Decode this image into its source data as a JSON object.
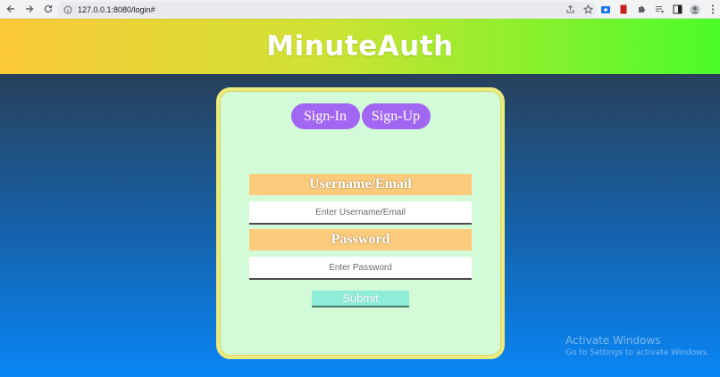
{
  "browser": {
    "url": "127.0.0.1:8080/login#"
  },
  "header": {
    "title": "MinuteAuth"
  },
  "tabs": [
    {
      "label": "Sign-In"
    },
    {
      "label": "Sign-Up"
    }
  ],
  "form": {
    "username_label": "Username/Email",
    "username_placeholder": "Enter Username/Email",
    "password_label": "Password",
    "password_placeholder": "Enter Password",
    "submit_label": "Submit"
  },
  "watermark": {
    "title": "Activate Windows",
    "subtitle": "Go to Settings to activate Windows."
  },
  "colors": {
    "header_start": "#fcc93a",
    "header_end": "#4bfc2a",
    "card_bg": "#d4fbd8",
    "tab_bg": "#a267f2",
    "label_bg": "#fccc7c",
    "submit_bg": "#8eecd9"
  },
  "icons": [
    "back-icon",
    "forward-icon",
    "reload-icon",
    "info-icon",
    "share-icon",
    "star-icon",
    "extension-icons",
    "menu-icon"
  ]
}
